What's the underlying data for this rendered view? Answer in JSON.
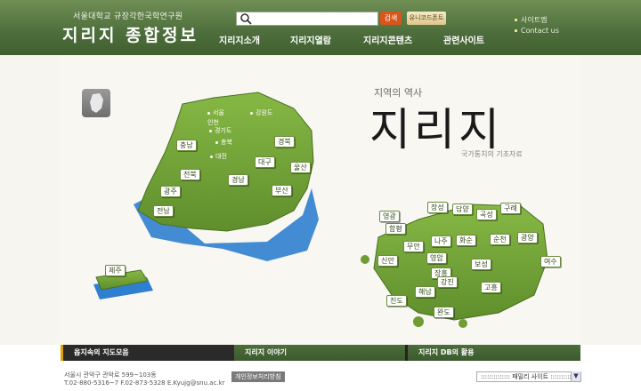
{
  "header": {
    "institution": "서울대학교 규장각한국학연구원",
    "brand": "지리지 종합정보",
    "search_placeholder": "",
    "search_button": "검색",
    "unicode_button": "유니코드폰트",
    "nav": [
      "지리지소개",
      "지리지열람",
      "지리지콘텐츠",
      "관련사이트"
    ],
    "util": [
      "사이트맵",
      "Contact us"
    ]
  },
  "hero": {
    "history": "지역의 역사",
    "title": "지리지",
    "subtitle": "국가통치의 기초자료"
  },
  "regions": {
    "tags": [
      "충남",
      "전북",
      "광주",
      "전남",
      "경북",
      "대구",
      "울산",
      "경남",
      "부산",
      "제주"
    ],
    "plain": [
      "서울",
      "인천",
      "강원도",
      "경기도",
      "충북",
      "대전"
    ]
  },
  "jeonnam_towns": [
    "영광",
    "장성",
    "담양",
    "곡성",
    "구례",
    "함평",
    "광양",
    "나주",
    "화순",
    "순천",
    "무안",
    "영암",
    "보성",
    "신안",
    "장흥",
    "여수",
    "강진",
    "고흥",
    "해남",
    "진도",
    "완도"
  ],
  "bottom_tabs": [
    "옵지속의 지도모음",
    "지리지 이야기",
    "지리지 DB의 활용"
  ],
  "footer": {
    "address": "서울시 관악구 관악로 599~103동",
    "contact": "T.02-880-5316~7 F.02-873-5328 E.Kyujg@snu.ac.kr",
    "privacy": "개인정보처리방침",
    "family_site": ":::::::::::::: 패밀리 사이트 ::::::::::::::"
  },
  "colors": {
    "header_green": "#4d6d3c",
    "land_green": "#7aa63a",
    "sea_blue": "#2f7fd0",
    "accent_orange": "#d7561c"
  }
}
